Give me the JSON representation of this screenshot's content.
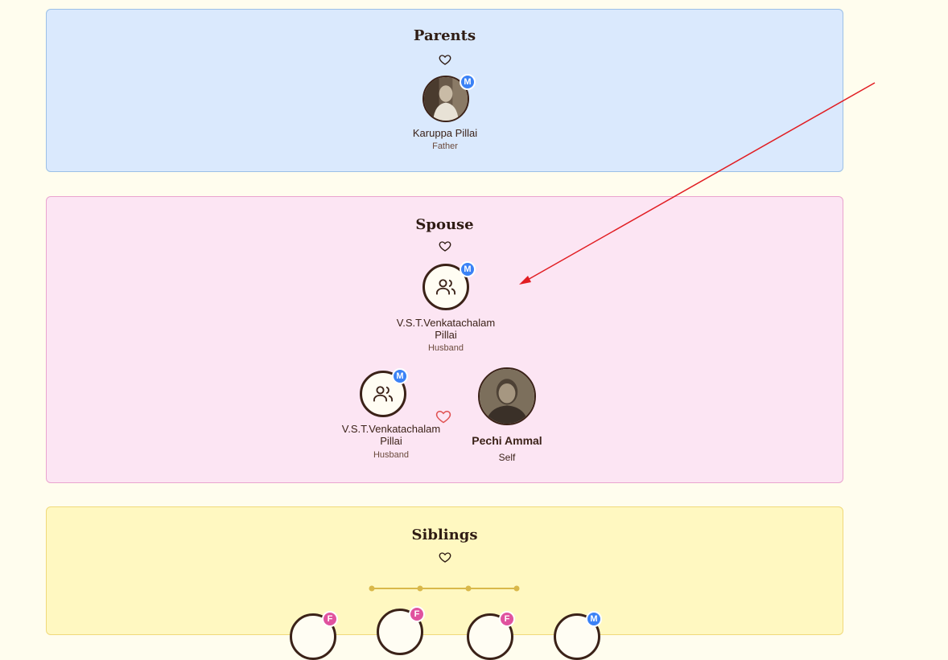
{
  "parents": {
    "title": "Parents",
    "members": [
      {
        "name": "Karuppa Pillai",
        "relation": "Father",
        "badge": "M"
      }
    ]
  },
  "spouse": {
    "title": "Spouse",
    "primary": {
      "name": "V.S.T.Venkatachalam Pillai",
      "relation": "Husband",
      "badge": "M",
      "icon": "users-icon"
    },
    "couple": {
      "partner": {
        "name": "V.S.T.Venkatachalam Pillai",
        "relation": "Husband",
        "badge": "M",
        "icon": "users-icon"
      },
      "self": {
        "name": "Pechi Ammal",
        "relation": "Self"
      }
    }
  },
  "siblings": {
    "title": "Siblings",
    "badges": [
      "F",
      "F",
      "F",
      "M"
    ]
  },
  "colors": {
    "male_badge": "#3b82f6",
    "female_badge": "#e0529e",
    "annotation_arrow": "#e11d22",
    "couple_heart": "#e05252"
  }
}
